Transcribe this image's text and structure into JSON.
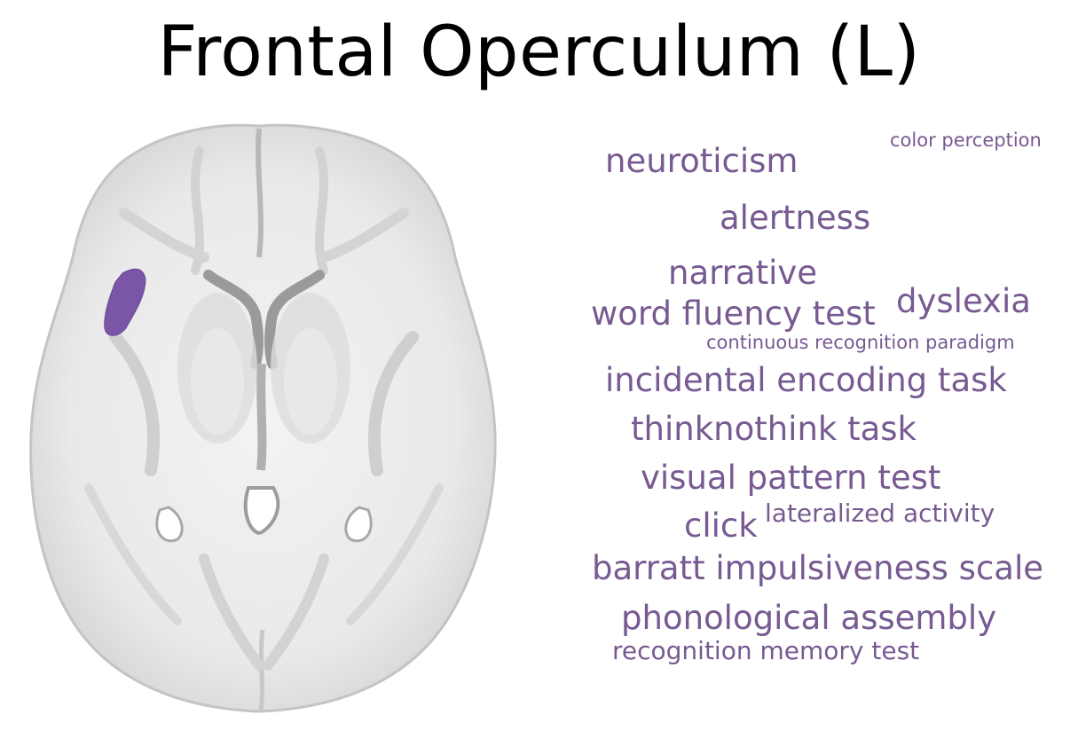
{
  "title": "Frontal Operculum (L)",
  "colors": {
    "term": "#775a91",
    "roi": "#7b55a6",
    "brain_fill": "#ededed",
    "brain_edge": "#bdbdbd"
  },
  "brain": {
    "view": "axial",
    "highlight": "left-frontal-operculum"
  },
  "terms": [
    {
      "text": "color perception"
    },
    {
      "text": "neuroticism"
    },
    {
      "text": "alertness"
    },
    {
      "text": "narrative"
    },
    {
      "text": "word fluency test"
    },
    {
      "text": "dyslexia"
    },
    {
      "text": "continuous recognition paradigm"
    },
    {
      "text": "incidental encoding task"
    },
    {
      "text": "thinknothink task"
    },
    {
      "text": "visual pattern test"
    },
    {
      "text": "click"
    },
    {
      "text": "lateralized activity"
    },
    {
      "text": "barratt impulsiveness scale"
    },
    {
      "text": "phonological assembly"
    },
    {
      "text": "recognition memory test"
    }
  ]
}
